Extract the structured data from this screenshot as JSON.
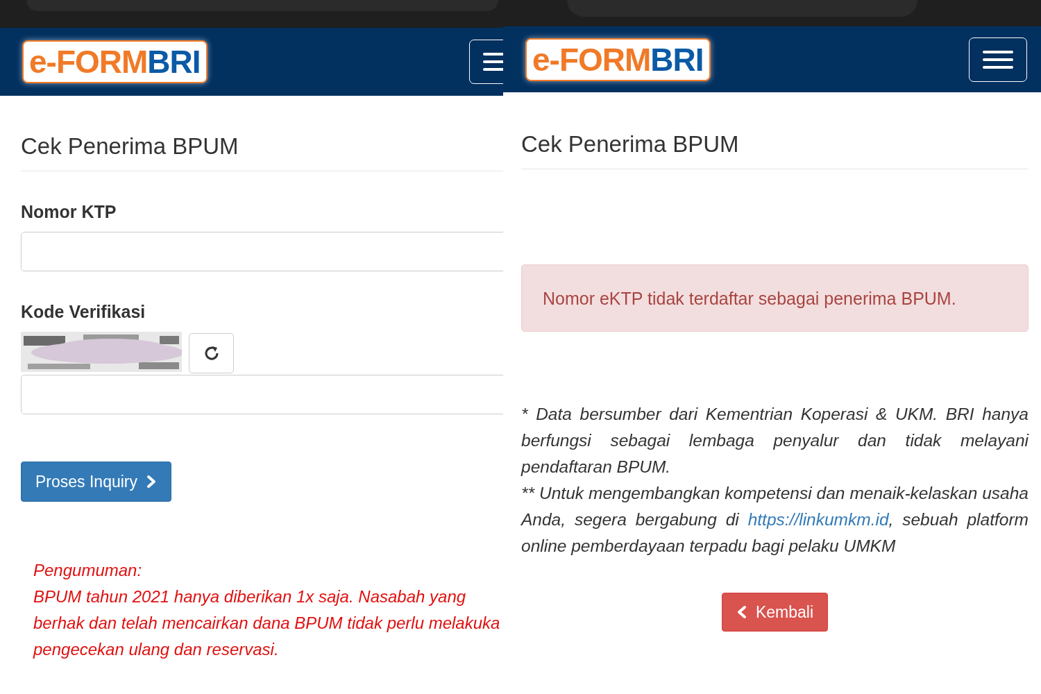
{
  "left_screen": {
    "logo": {
      "part_1": "e-FORM",
      "part_2": "BRI"
    },
    "title": "Cek Penerima BPUM",
    "fields": [
      {
        "label": "Nomor KTP",
        "kind": "text"
      },
      {
        "label": "Kode Verifikasi",
        "kind": "captcha"
      }
    ],
    "submit_button": "Proses Inquiry",
    "announcement": [
      "Pengumuman:",
      "BPUM tahun 2021 hanya diberikan 1x saja. Nasabah yang",
      "berhak dan telah mencairkan dana BPUM tidak perlu melakuka",
      "pengecekan ulang dan reservasi."
    ]
  },
  "right_screen": {
    "logo": {
      "part_1": "e-FORM",
      "part_2": "BRI"
    },
    "title": "Cek Penerima BPUM",
    "alert": "Nomor eKTP tidak terdaftar sebagai penerima BPUM.",
    "note_1": "* Data bersumber dari Kementrian Koperasi & UKM. BRI hanya berfungsi sebagai lembaga penyalur dan tidak melayani pendaftaran BPUM.",
    "note_2": {
      "before": "** Untuk mengembangkan kompetensi dan menaik-kelaskan usaha Anda, segera bergabung di ",
      "link": "https://linkumkm.id",
      "after": ", sebuah platform online pemberdayaan terpadu bagi pelaku UMKM"
    },
    "back_button": "Kembali"
  }
}
